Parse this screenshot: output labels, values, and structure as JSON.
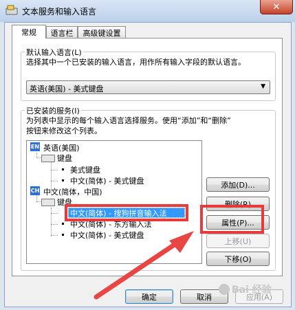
{
  "window": {
    "title": "文本服务和输入语言",
    "close_glyph": "✕"
  },
  "tabs": [
    {
      "label": "常规",
      "active": true
    },
    {
      "label": "语言栏",
      "active": false
    },
    {
      "label": "高级键设置",
      "active": false
    }
  ],
  "default_language": {
    "legend": "默认输入语言(L)",
    "description": "选择其中一个已安装的输入语言，用作所有输入字段的默认语言。",
    "selected": "英语(美国) - 美式键盘",
    "arrow": "▼"
  },
  "installed_services": {
    "legend": "已安装的服务(I)",
    "description_line1": "为列表中显示的每个输入语言选择服务。使用“添加”和“删除”",
    "description_line2": "按钮来修改这个列表。",
    "tree": {
      "lang1": {
        "badge": "EN",
        "label": "英语(美国)"
      },
      "lang1_keyboard": "键盘",
      "lang1_items": [
        "美式键盘",
        "中文(简体) - 美式键盘"
      ],
      "lang2": {
        "badge": "CH",
        "label": "中文(简体，中国)"
      },
      "lang2_keyboard": "键盘",
      "lang2_items": [
        "中文(简体) - 搜狗拼音输入法",
        "中文(简体) - 东方输入法",
        "中文(简体) - 美式键盘"
      ]
    },
    "buttons": {
      "add": "添加(D)...",
      "remove": "删除(R)",
      "properties": "属性(P)...",
      "move_up": "上移(U)",
      "move_down": "下移(O)"
    }
  },
  "footer": {
    "ok": "确定",
    "cancel": "取消",
    "apply": "应用(A)"
  },
  "watermark": "Bai 经验",
  "colors": {
    "highlight_box": "#e83a3a",
    "selection": "#3399ff",
    "badge": "#2f6fd6"
  }
}
